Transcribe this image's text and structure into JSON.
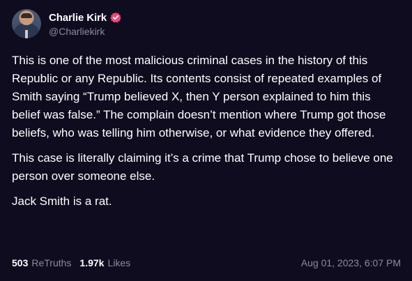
{
  "author": {
    "display_name": "Charlie Kirk",
    "handle": "@Charliekirk",
    "verified_color": "#f0467a"
  },
  "post": {
    "paragraphs": [
      "This is one of the most malicious criminal cases in the history of this Republic or any Republic. Its contents consist of repeated examples of Smith saying “Trump believed X, then Y person explained to him this belief was false.” The complain doesn’t mention where Trump got those beliefs, who was telling him otherwise, or what evidence they offered.",
      "This case is literally claiming it’s a crime that Trump chose to believe one person over someone else.",
      "Jack Smith is a rat."
    ]
  },
  "stats": {
    "retruths_count": "503",
    "retruths_label": "ReTruths",
    "likes_count": "1.97k",
    "likes_label": "Likes",
    "timestamp": "Aug 01, 2023, 6:07 PM"
  },
  "colors": {
    "background": "#0e0c1e",
    "muted_text": "#8d8ba3"
  }
}
